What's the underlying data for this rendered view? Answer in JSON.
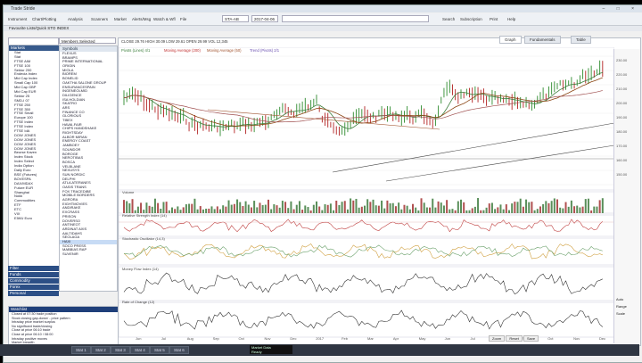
{
  "window": {
    "title": "Trade Stride",
    "controls": [
      "–",
      "□",
      "×"
    ]
  },
  "toolbar": {
    "buttons": [
      "Instrument",
      "Chart/Plotting",
      "Analysis",
      "Scanners",
      "Market",
      "Alerts/Msg",
      "Watch & Wfl",
      "File"
    ],
    "symbol_value": "STA-AB",
    "date_value": "2017-04-06",
    "right_buttons": [
      "Search",
      "Subscription",
      "Print",
      "Help"
    ]
  },
  "subbar": {
    "text": "Favourite Lists/Quick STO INDEX"
  },
  "left_panel": {
    "header": "Markets",
    "items": [
      "Stat",
      "Stat",
      "FTSE AIM",
      "FTSE 100",
      "Sektor 200",
      "Endecia Index",
      "Mid Cap Index",
      "Small Cap 100",
      "Mid Cap GBP",
      "Mid Cap EUR",
      "Sektor 25",
      "SMD-I 07",
      "FTSE 250",
      "FTSE 350",
      "FTSE Small",
      "Europe 100",
      "FTSE Index",
      "FTSE Index",
      "FTSE IdA",
      "DOW JONES",
      "DOW JONES",
      "DOW JONES",
      "DOW JONES",
      "Beurse Kaven",
      "Index Stock",
      "Index Select",
      "India Option",
      "Daily Euro",
      "BSE (Futures)",
      "BOVESPA",
      "DAX/MDAX",
      "Future EUR",
      "Shanghai",
      "Nokk",
      "Commodities",
      "ETF",
      "ETC",
      "VIX",
      "EIWU Euro"
    ],
    "footer_tabs": [
      "Filter",
      "Funds",
      "Commodity",
      "Forex",
      "Personal"
    ]
  },
  "symbol_list": {
    "dropdown": "Members Selected",
    "header": "Symbols",
    "items": [
      "FLEXUS",
      "BRAMPS",
      "PRIME INTERNATIONAL",
      "ORIGIN",
      "MIOLA",
      "BIOREM",
      "BONELID",
      "OAKTHA SALONE GROUP",
      "ENSURANCESPAIN",
      "INGENEOLMID",
      "DILIGENCE",
      "ISA HOLDIAN",
      "SKATRO",
      "ARS",
      "FINANCE CO",
      "GLORIOUS",
      "TIBEX",
      "HAVAI-FAIR",
      "CHIPS HANDSHAKE",
      "RIGHTSDAY",
      "ALBOR MIRAN",
      "ENERGY COAST",
      "JAMBOEY",
      "SOUNDOR",
      "BOROGE",
      "NEROTIBAS",
      "BOSCA",
      "VELBLANE",
      "NEXUSYS",
      "SUN NORDIC",
      "DELPHI",
      "ATLA ATERANES",
      "OASIS TRANS",
      "FOX TRACEDIBE",
      "MOBILE BORDERS",
      "AGRORA",
      "EIGHTMOVIES",
      "ANDIRAKE",
      "EXCRASS",
      "PRISON",
      "DOVERSO",
      "ANTINEOT",
      "ARDINAT AXIS",
      "AALTIDAHS",
      "SEOLAGA",
      "HAXI",
      "SOCO PRESS",
      "MABBIAS RAP",
      "SUVENIR"
    ],
    "selected_index": 45
  },
  "chart": {
    "tabs": [
      "Graph",
      "Fundamentals",
      "Table"
    ],
    "active_tab": "Graph",
    "header_info": "CLOSE 29.76  HIGH 30.09  LOW 29.61  OPEN 29.99  VOL 12,345",
    "legend": [
      {
        "label": "Pivots (Lines) 4/1",
        "color": "#3a7d3a"
      },
      {
        "label": "Moving Average (200)",
        "color": "#c03030"
      },
      {
        "label": "Moving Average (50)",
        "color": "#a0522d"
      },
      {
        "label": "Trend (Pivots) 2/1",
        "color": "#6a4fb0"
      }
    ],
    "price_axis": [
      "230.00",
      "220.00",
      "210.00",
      "200.00",
      "190.00",
      "180.00",
      "170.00",
      "160.00",
      "150.00"
    ],
    "x_axis": [
      "Jun",
      "Jul",
      "Aug",
      "Sep",
      "Oct",
      "Nov",
      "Dec",
      "2017",
      "Feb",
      "Mar",
      "Apr",
      "May",
      "Jun",
      "Jul",
      "Aug",
      "Sep",
      "Oct",
      "Nov",
      "Dec"
    ],
    "indicator_labels": [
      "Volume",
      "Relative Strength Index (14)",
      "Stochastic Oscillator (14,3)",
      "Money Flow Index (14)",
      "Rate of Change (12)"
    ],
    "right_strip_buttons": [
      "Auto",
      "Range",
      "Scale"
    ],
    "bottom_controls": [
      "Zoom",
      "Reset",
      "Save"
    ]
  },
  "bottom_list": {
    "header": "Watchlist",
    "items": [
      "Closed at 07:30 trade position",
      "Stock closing gap-down/ - price pattern",
      "Intraday price market surplus",
      "No significant trade/closing",
      "Close at price 06:10 trade",
      "Close at price 06:10 / 08:00",
      "Intraday positive moves",
      "Market breadth"
    ]
  },
  "status_bar": {
    "tabs": [
      "Stat 1",
      "Stat 2",
      "Stat 3",
      "Stat 4",
      "Stat 5",
      "Stat 6"
    ],
    "info_line1": "Market Data",
    "info_line2": "Ready"
  }
}
